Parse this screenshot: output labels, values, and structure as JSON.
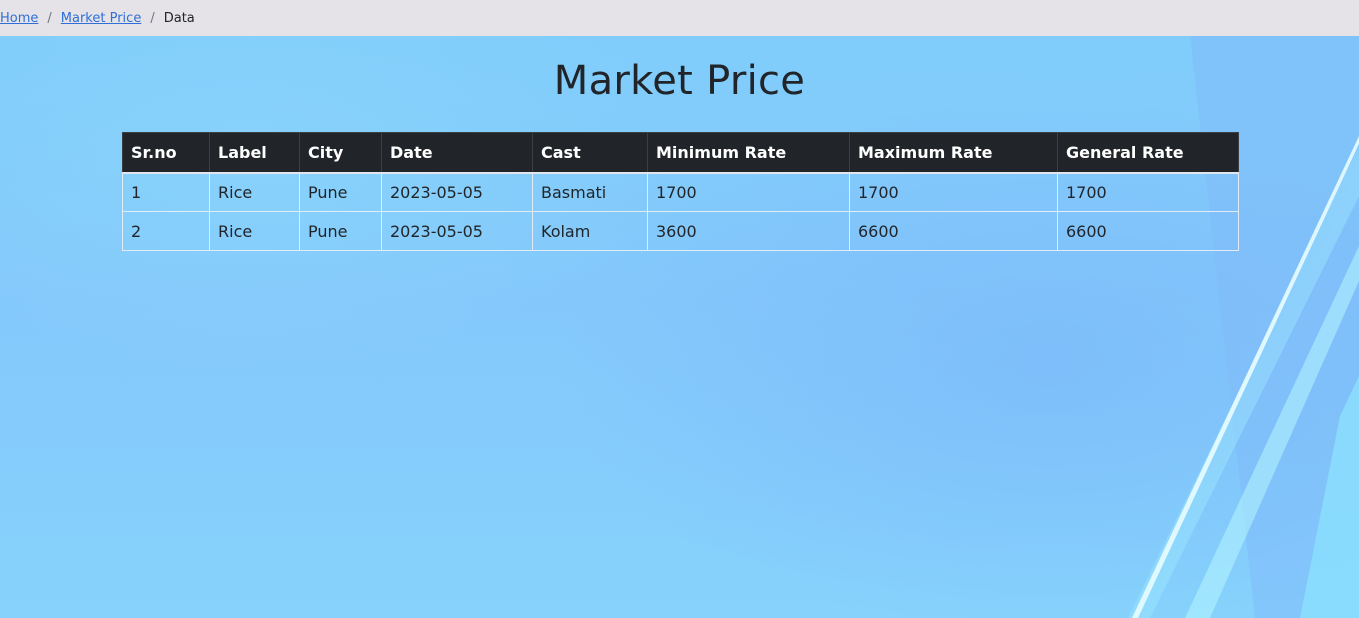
{
  "breadcrumb": {
    "items": [
      {
        "label": "Home",
        "link": true
      },
      {
        "label": "Market Price",
        "link": true
      },
      {
        "label": "Data",
        "link": false
      }
    ],
    "separator": "/"
  },
  "page": {
    "title": "Market Price"
  },
  "table": {
    "columns": [
      "Sr.no",
      "Label",
      "City",
      "Date",
      "Cast",
      "Minimum Rate",
      "Maximum Rate",
      "General Rate"
    ],
    "rows": [
      [
        "1",
        "Rice",
        "Pune",
        "2023-05-05",
        "Basmati",
        "1700",
        "1700",
        "1700"
      ],
      [
        "2",
        "Rice",
        "Pune",
        "2023-05-05",
        "Kolam",
        "3600",
        "6600",
        "6600"
      ]
    ]
  },
  "colors": {
    "breadcrumb_bg": "#e6e3e8",
    "link": "#2f6fd6",
    "table_header_bg": "#212529",
    "page_bg": "#84cdfb"
  }
}
